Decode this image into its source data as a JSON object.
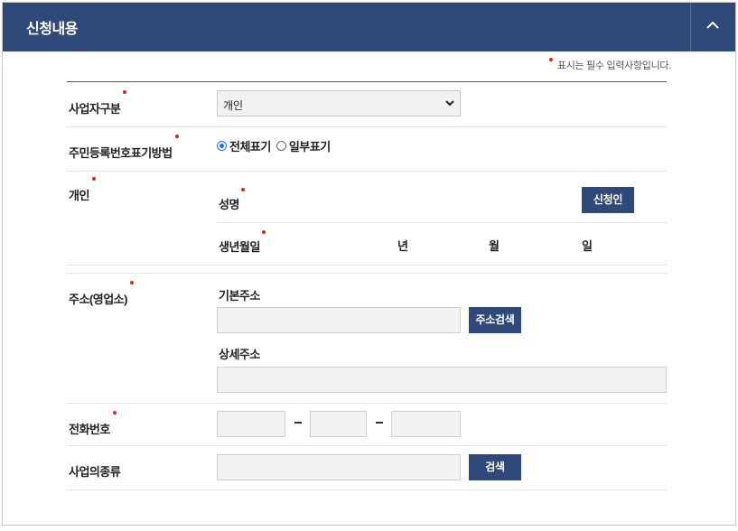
{
  "header": {
    "title": "신청내용"
  },
  "legend": {
    "text": "표시는 필수 입력사항입니다."
  },
  "fields": {
    "business_type": {
      "label": "사업자구분",
      "selected": "개인"
    },
    "resident_display": {
      "label": "주민등록번호표기방법",
      "options": [
        {
          "label": "전체표기",
          "checked": true
        },
        {
          "label": "일부표기",
          "checked": false
        }
      ]
    },
    "individual": {
      "label": "개인",
      "name_label": "성명",
      "applicant_button": "신청인",
      "birth_label": "생년월일",
      "year_unit": "년",
      "month_unit": "월",
      "day_unit": "일"
    },
    "address": {
      "label": "주소(영업소)",
      "basic_label": "기본주소",
      "search_button": "주소검색",
      "detail_label": "상세주소"
    },
    "phone": {
      "label": "전화번호"
    },
    "business_kind": {
      "label": "사업의종류",
      "search_button": "검색"
    }
  }
}
